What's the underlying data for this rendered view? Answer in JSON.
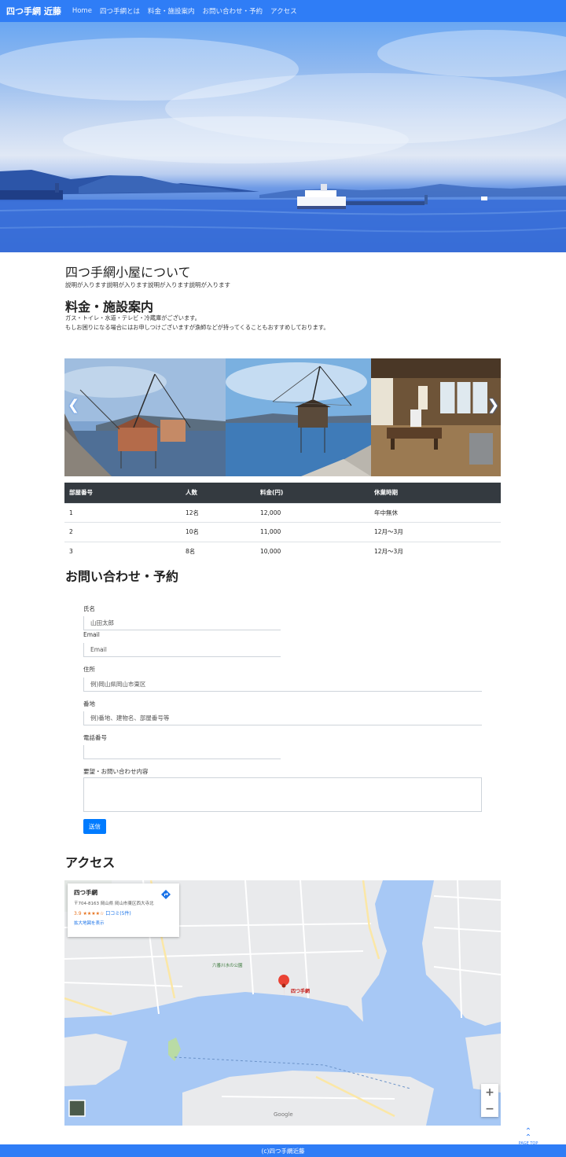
{
  "nav": {
    "brand": "四つ手網 近藤",
    "items": [
      "Home",
      "四つ手網とは",
      "料金・施設案内",
      "お問い合わせ・予約",
      "アクセス"
    ]
  },
  "about": {
    "title": "四つ手網小屋について",
    "text": "説明が入ります説明が入ります説明が入ります説明が入ります"
  },
  "price": {
    "title": "料金・施設案内",
    "line1": "ガス・トイレ・水道・テレビ・冷蔵庫がございます。",
    "line2": "もしお困りになる場合にはお申しつけございますが漁師などが持ってくることもおすすめしております。"
  },
  "table": {
    "headers": [
      "部屋番号",
      "人数",
      "料金(円)",
      "休業時期"
    ],
    "rows": [
      [
        "1",
        "12名",
        "12,000",
        "年中無休"
      ],
      [
        "2",
        "10名",
        "11,000",
        "12月〜3月"
      ],
      [
        "3",
        "8名",
        "10,000",
        "12月〜3月"
      ]
    ]
  },
  "contact": {
    "title": "お問い合わせ・予約",
    "name_label": "氏名",
    "name_placeholder": "山田太郎",
    "email_label": "Email",
    "email_placeholder": "Email",
    "address_label": "住所",
    "address_placeholder": "例)岡山県岡山市東区",
    "building_label": "番地",
    "building_placeholder": "例)番地、建物名、部屋番号等",
    "phone_label": "電話番号",
    "message_label": "要望・お問い合わせ内容",
    "submit": "送信"
  },
  "access": {
    "title": "アクセス",
    "card_name": "四つ手網",
    "card_address": "〒704-8163 岡山県 岡山市東区西大寺北",
    "card_rating": "3.9 ★★★★☆",
    "card_reviews": "口コミ(5件)",
    "card_link": "拡大地図を表示",
    "pin_label": "四つ手網",
    "place_1": "六番川水の公園",
    "google": "Google",
    "zoom_in": "+",
    "zoom_out": "−"
  },
  "pagetop": "PAGE TOP",
  "footer": "(c)四つ手網近藤",
  "colors": {
    "accent": "#2f7df6",
    "table_header": "#343a40",
    "button": "#007bff"
  },
  "icons": [
    "chevron-left-icon",
    "chevron-right-icon",
    "directions-icon",
    "map-pin-icon",
    "chevron-up-icon"
  ]
}
